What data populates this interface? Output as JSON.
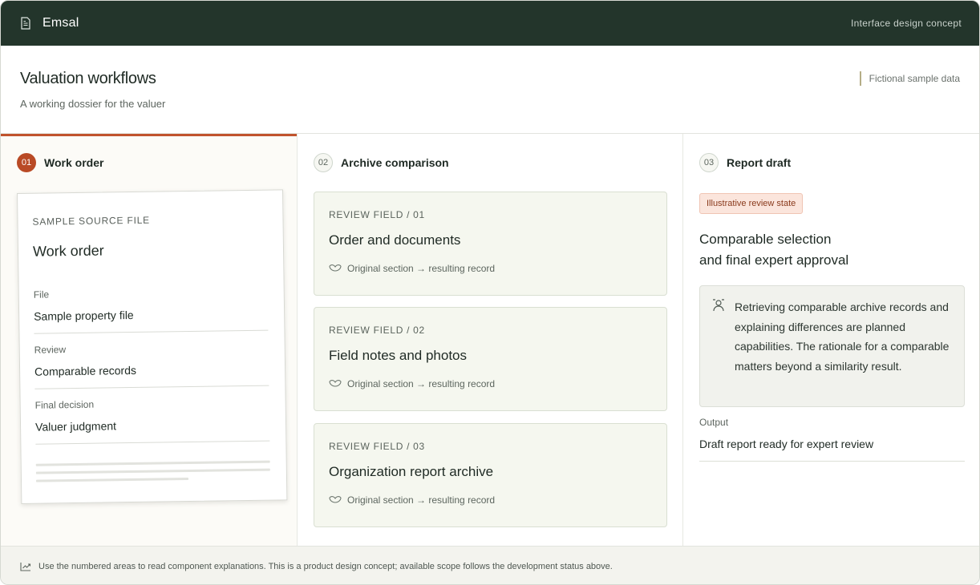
{
  "topbar": {
    "brand": "Emsal",
    "brand_icon": "document-icon",
    "concept_label": "Interface design concept"
  },
  "header": {
    "title": "Valuation workflows",
    "subtitle": "A working dossier for the valuer",
    "sample_tag": "Fictional sample data"
  },
  "columns": [
    {
      "number": "01",
      "label": "Work order",
      "active": true,
      "paper": {
        "eyebrow": "SAMPLE SOURCE FILE",
        "title": "Work order",
        "fields": [
          {
            "label": "File",
            "value": "Sample property file"
          },
          {
            "label": "Review",
            "value": "Comparable records"
          },
          {
            "label": "Final decision",
            "value": "Valuer judgment"
          }
        ]
      }
    },
    {
      "number": "02",
      "label": "Archive comparison",
      "active": false,
      "cards": [
        {
          "field": "REVIEW FIELD / 01",
          "title": "Order and documents",
          "link_text": "Original section → resulting record"
        },
        {
          "field": "REVIEW FIELD / 02",
          "title": "Field notes and photos",
          "link_text": "Original section → resulting record"
        },
        {
          "field": "REVIEW FIELD / 03",
          "title": "Organization report archive",
          "link_text": "Original section → resulting record"
        }
      ]
    },
    {
      "number": "03",
      "label": "Report draft",
      "active": false,
      "badge": "Illustrative review state",
      "title_line1": "Comparable selection",
      "title_line2": "and final expert approval",
      "note": "Retrieving comparable archive records and explaining differences are planned capabilities. The rationale for a comparable matters beyond a similarity result.",
      "output_label": "Output",
      "output_value": "Draft report ready for expert review"
    }
  ],
  "footer": {
    "text": "Use the numbered areas to read component explanations. This is a product design concept; available scope follows the development status above."
  },
  "colors": {
    "topbar": "#23352b",
    "accent": "#b94a25",
    "card_bg": "#f5f7ef"
  }
}
